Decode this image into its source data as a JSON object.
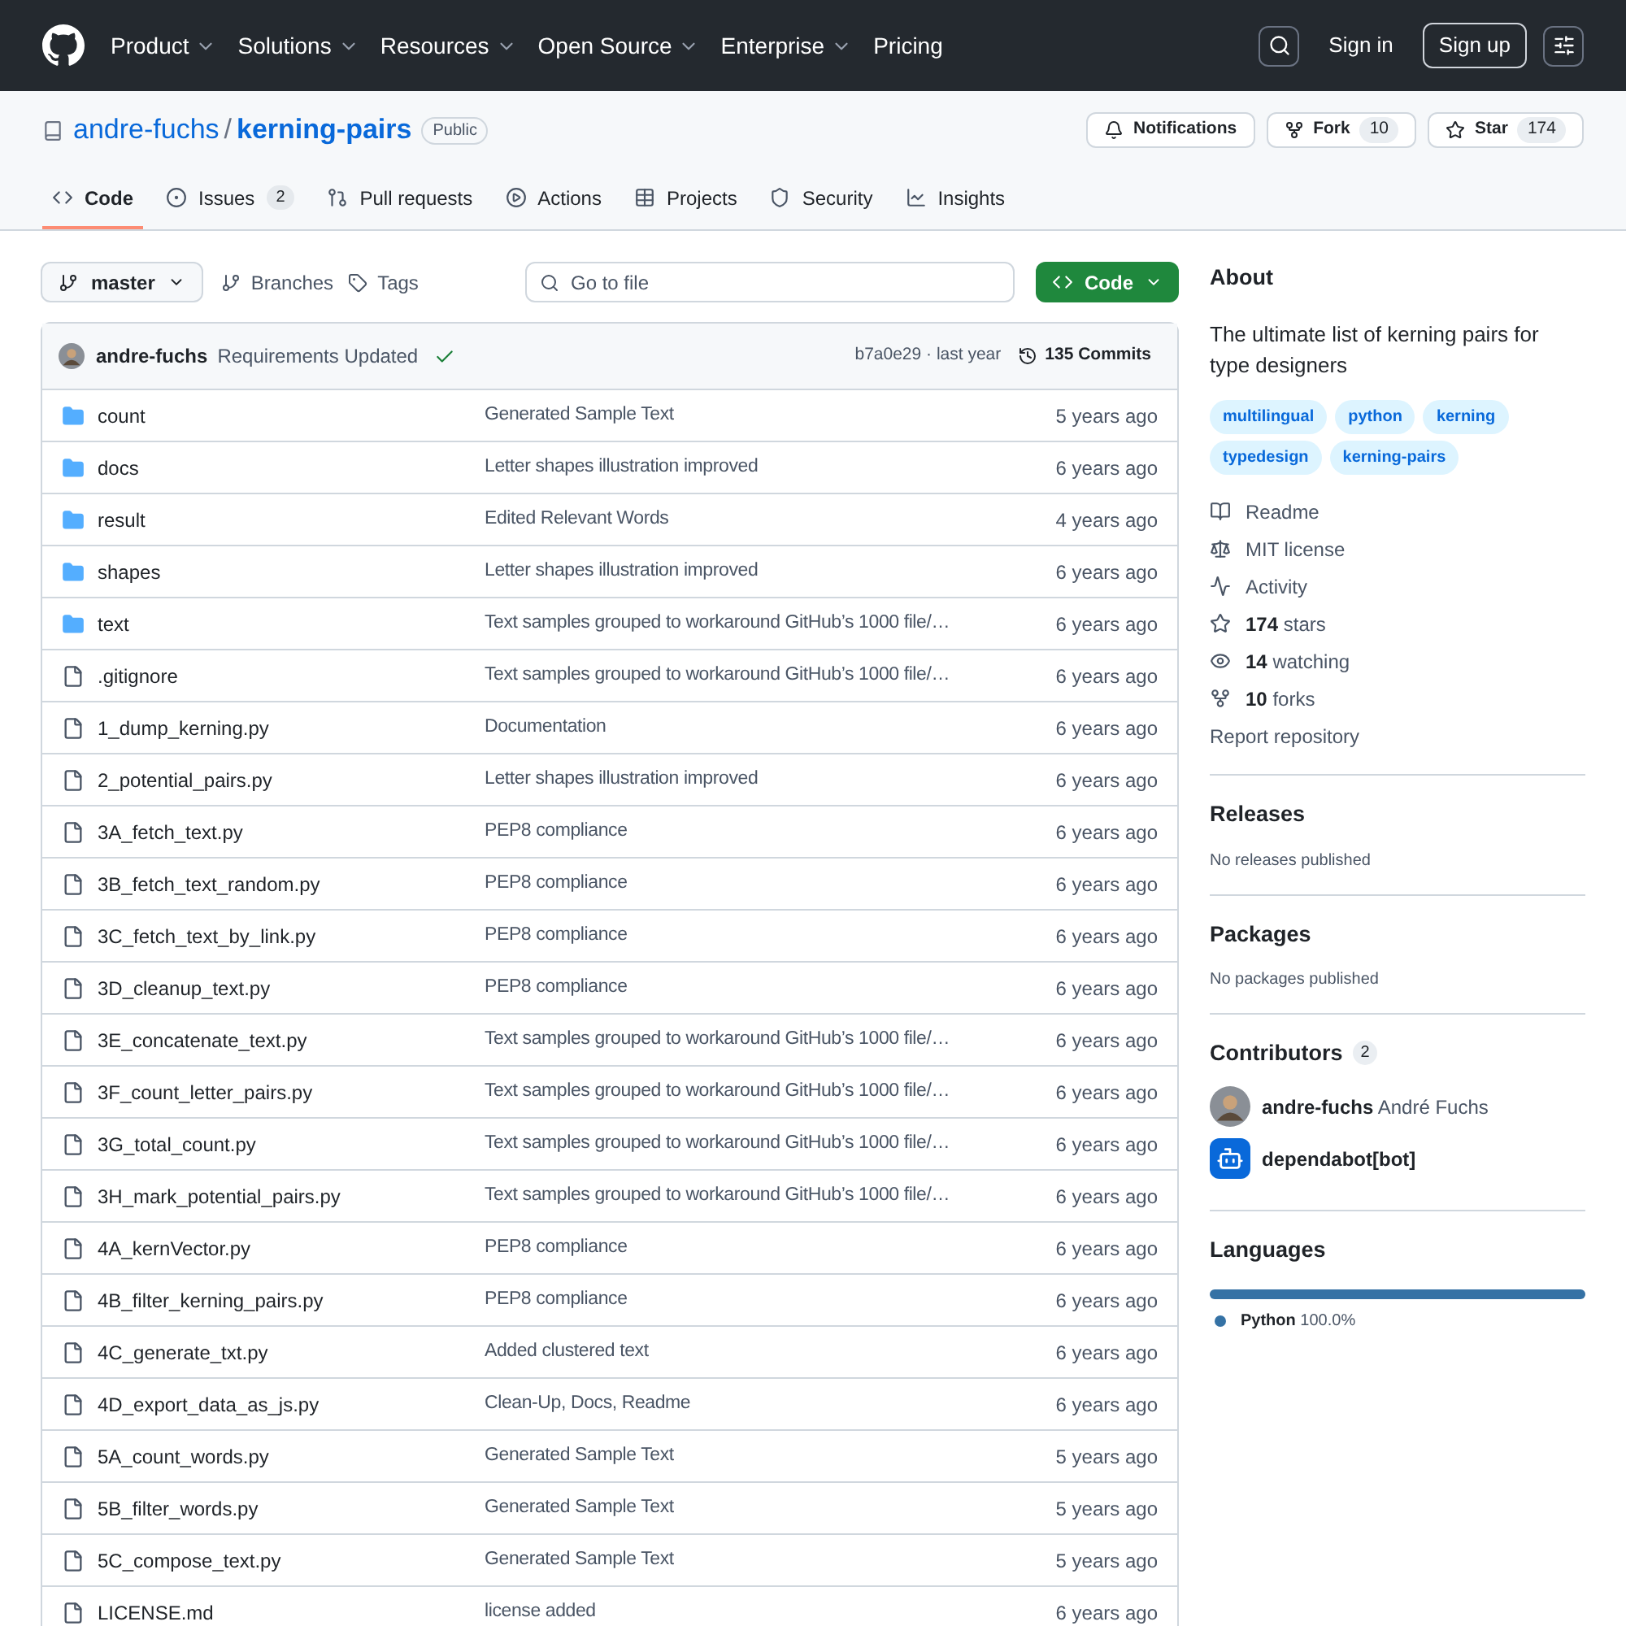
{
  "header": {
    "nav": [
      "Product",
      "Solutions",
      "Resources",
      "Open Source",
      "Enterprise",
      "Pricing"
    ],
    "sign_in": "Sign in",
    "sign_up": "Sign up"
  },
  "repo": {
    "owner": "andre-fuchs",
    "separator": "/",
    "name": "kerning-pairs",
    "visibility": "Public",
    "notifications": "Notifications",
    "fork": "Fork",
    "fork_count": "10",
    "star": "Star",
    "star_count": "174"
  },
  "tabs": [
    {
      "label": "Code",
      "selected": true,
      "kind": "code"
    },
    {
      "label": "Issues",
      "count": "2",
      "selected": false,
      "kind": "issues"
    },
    {
      "label": "Pull requests",
      "selected": false,
      "kind": "pulls"
    },
    {
      "label": "Actions",
      "selected": false,
      "kind": "actions"
    },
    {
      "label": "Projects",
      "selected": false,
      "kind": "projects"
    },
    {
      "label": "Security",
      "selected": false,
      "kind": "security"
    },
    {
      "label": "Insights",
      "selected": false,
      "kind": "insights"
    }
  ],
  "toolbar": {
    "branch": "master",
    "branches": "Branches",
    "tags": "Tags",
    "search": {
      "placeholder": "Go to file"
    },
    "code_button": "Code"
  },
  "last_commit": {
    "author": "andre-fuchs",
    "message": "Requirements Updated",
    "hash_time": "b7a0e29 · last year",
    "commits": "135 Commits"
  },
  "files": [
    {
      "kind": "folder",
      "name": "count",
      "message": "Generated Sample Text",
      "time": "5 years ago"
    },
    {
      "kind": "folder",
      "name": "docs",
      "message": "Letter shapes illustration improved",
      "time": "6 years ago"
    },
    {
      "kind": "folder",
      "name": "result",
      "message": "Edited Relevant Words",
      "time": "4 years ago"
    },
    {
      "kind": "folder",
      "name": "shapes",
      "message": "Letter shapes illustration improved",
      "time": "6 years ago"
    },
    {
      "kind": "folder",
      "name": "text",
      "message": "Text samples grouped to workaround GitHub’s 1000 file/…",
      "time": "6 years ago"
    },
    {
      "kind": "file",
      "name": ".gitignore",
      "message": "Text samples grouped to workaround GitHub’s 1000 file/…",
      "time": "6 years ago"
    },
    {
      "kind": "file",
      "name": "1_dump_kerning.py",
      "message": "Documentation",
      "time": "6 years ago"
    },
    {
      "kind": "file",
      "name": "2_potential_pairs.py",
      "message": "Letter shapes illustration improved",
      "time": "6 years ago"
    },
    {
      "kind": "file",
      "name": "3A_fetch_text.py",
      "message": "PEP8 compliance",
      "time": "6 years ago"
    },
    {
      "kind": "file",
      "name": "3B_fetch_text_random.py",
      "message": "PEP8 compliance",
      "time": "6 years ago"
    },
    {
      "kind": "file",
      "name": "3C_fetch_text_by_link.py",
      "message": "PEP8 compliance",
      "time": "6 years ago"
    },
    {
      "kind": "file",
      "name": "3D_cleanup_text.py",
      "message": "PEP8 compliance",
      "time": "6 years ago"
    },
    {
      "kind": "file",
      "name": "3E_concatenate_text.py",
      "message": "Text samples grouped to workaround GitHub’s 1000 file/…",
      "time": "6 years ago"
    },
    {
      "kind": "file",
      "name": "3F_count_letter_pairs.py",
      "message": "Text samples grouped to workaround GitHub’s 1000 file/…",
      "time": "6 years ago"
    },
    {
      "kind": "file",
      "name": "3G_total_count.py",
      "message": "Text samples grouped to workaround GitHub’s 1000 file/…",
      "time": "6 years ago"
    },
    {
      "kind": "file",
      "name": "3H_mark_potential_pairs.py",
      "message": "Text samples grouped to workaround GitHub’s 1000 file/…",
      "time": "6 years ago"
    },
    {
      "kind": "file",
      "name": "4A_kernVector.py",
      "message": "PEP8 compliance",
      "time": "6 years ago"
    },
    {
      "kind": "file",
      "name": "4B_filter_kerning_pairs.py",
      "message": "PEP8 compliance",
      "time": "6 years ago"
    },
    {
      "kind": "file",
      "name": "4C_generate_txt.py",
      "message": "Added clustered text",
      "time": "6 years ago"
    },
    {
      "kind": "file",
      "name": "4D_export_data_as_js.py",
      "message": "Clean-Up, Docs, Readme",
      "time": "6 years ago"
    },
    {
      "kind": "file",
      "name": "5A_count_words.py",
      "message": "Generated Sample Text",
      "time": "5 years ago"
    },
    {
      "kind": "file",
      "name": "5B_filter_words.py",
      "message": "Generated Sample Text",
      "time": "5 years ago"
    },
    {
      "kind": "file",
      "name": "5C_compose_text.py",
      "message": "Generated Sample Text",
      "time": "5 years ago"
    },
    {
      "kind": "file",
      "name": "LICENSE.md",
      "message": "license added",
      "time": "6 years ago"
    }
  ],
  "about": {
    "title": "About",
    "description": "The ultimate list of kerning pairs for type designers",
    "topics": [
      "multilingual",
      "python",
      "kerning",
      "typedesign",
      "kerning-pairs"
    ],
    "links": [
      {
        "kind": "readme",
        "label": "Readme"
      },
      {
        "kind": "license",
        "label": "MIT license"
      },
      {
        "kind": "activity",
        "label": "Activity"
      },
      {
        "kind": "stars",
        "count": "174",
        "label": "stars"
      },
      {
        "kind": "watching",
        "count": "14",
        "label": "watching"
      },
      {
        "kind": "forks",
        "count": "10",
        "label": "forks"
      }
    ],
    "report": "Report repository"
  },
  "releases": {
    "title": "Releases",
    "note": "No releases published"
  },
  "packages": {
    "title": "Packages",
    "note": "No packages published"
  },
  "contributors": {
    "title": "Contributors",
    "count": "2",
    "people": [
      {
        "kind": "user",
        "login": "andre-fuchs",
        "name": "André Fuchs"
      },
      {
        "kind": "bot",
        "login": "dependabot[bot]"
      }
    ]
  },
  "languages": {
    "title": "Languages",
    "items": [
      {
        "name": "Python",
        "percent": "100.0%",
        "level": 1,
        "color": "#3572a5"
      }
    ]
  }
}
